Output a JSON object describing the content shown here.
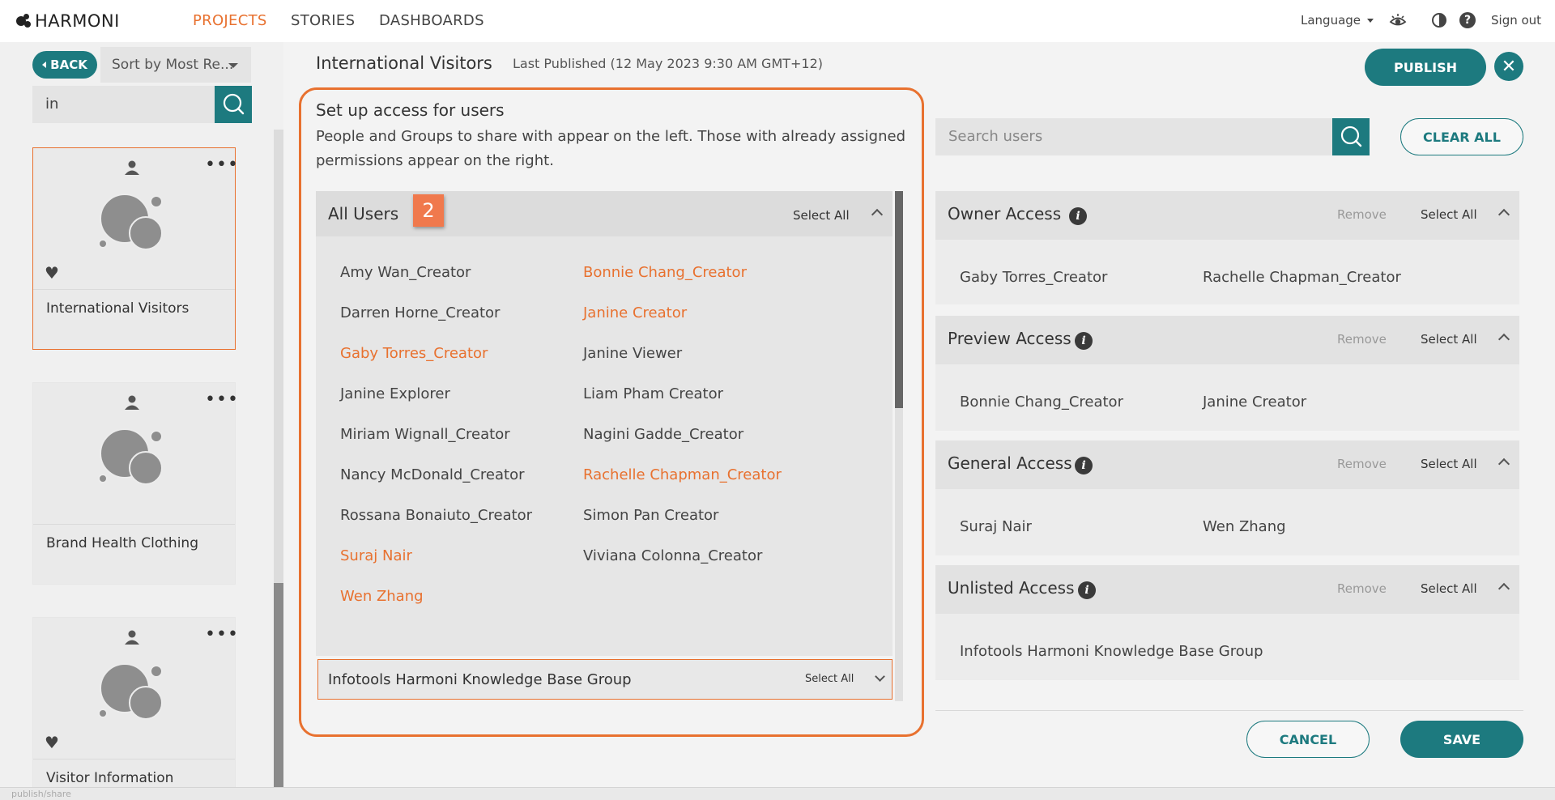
{
  "brand": {
    "name": "HARMONI"
  },
  "nav": {
    "tabs": [
      {
        "label": "PROJECTS"
      },
      {
        "label": "STORIES"
      },
      {
        "label": "DASHBOARDS"
      }
    ],
    "language": "Language",
    "sign_out": "Sign out",
    "help": "?"
  },
  "sidebar": {
    "back_label": "BACK",
    "sort_value": "Sort by Most Re...",
    "search_value": "in",
    "projects": [
      {
        "title": "International Visitors"
      },
      {
        "title": "Brand Health Clothing"
      },
      {
        "title": "Visitor Information"
      }
    ]
  },
  "main": {
    "title": "International Visitors",
    "last_published": "Last Published (12 May 2023 9:30 AM GMT+12)",
    "publish_label": "PUBLISH",
    "close_glyph": "✕"
  },
  "setup": {
    "title": "Set up access for users",
    "description": "People and Groups to share with appear on the left. Those with already assigned permissions appear on the right."
  },
  "all_users": {
    "title": "All Users",
    "step_badge": "2",
    "select_all": "Select All",
    "users": [
      {
        "name": "Amy Wan_Creator",
        "assigned": false
      },
      {
        "name": "Bonnie Chang_Creator",
        "assigned": true
      },
      {
        "name": "Darren Horne_Creator",
        "assigned": false
      },
      {
        "name": "Janine Creator",
        "assigned": true
      },
      {
        "name": "Gaby Torres_Creator",
        "assigned": true
      },
      {
        "name": "Janine Viewer",
        "assigned": false
      },
      {
        "name": "Janine Explorer",
        "assigned": false
      },
      {
        "name": "Liam Pham Creator",
        "assigned": false
      },
      {
        "name": "Miriam Wignall_Creator",
        "assigned": false
      },
      {
        "name": "Nagini Gadde_Creator",
        "assigned": false
      },
      {
        "name": "Nancy McDonald_Creator",
        "assigned": false
      },
      {
        "name": "Rachelle Chapman_Creator",
        "assigned": true
      },
      {
        "name": "Rossana Bonaiuto_Creator",
        "assigned": false
      },
      {
        "name": "Simon Pan Creator",
        "assigned": false
      },
      {
        "name": "Suraj Nair",
        "assigned": true
      },
      {
        "name": "Viviana Colonna_Creator",
        "assigned": false
      },
      {
        "name": "Wen Zhang",
        "assigned": true
      }
    ]
  },
  "group": {
    "name": "Infotools Harmoni Knowledge Base Group",
    "select_all": "Select All"
  },
  "right": {
    "search_placeholder": "Search users",
    "clear_all_label": "CLEAR ALL",
    "sections": [
      {
        "title": "Owner Access",
        "remove": "Remove",
        "select_all": "Select All",
        "users": [
          "Gaby Torres_Creator",
          "Rachelle Chapman_Creator"
        ]
      },
      {
        "title": "Preview Access",
        "remove": "Remove",
        "select_all": "Select All",
        "users": [
          "Bonnie Chang_Creator",
          "Janine Creator"
        ]
      },
      {
        "title": "General Access",
        "remove": "Remove",
        "select_all": "Select All",
        "users": [
          "Suraj Nair",
          "Wen Zhang"
        ]
      },
      {
        "title": "Unlisted Access",
        "remove": "Remove",
        "select_all": "Select All",
        "users": [
          "Infotools Harmoni Knowledge Base Group"
        ]
      }
    ]
  },
  "footer": {
    "cancel_label": "CANCEL",
    "save_label": "SAVE",
    "status_text": "publish/share"
  },
  "colors": {
    "accent": "#e8712f",
    "teal": "#1d7a7f"
  }
}
